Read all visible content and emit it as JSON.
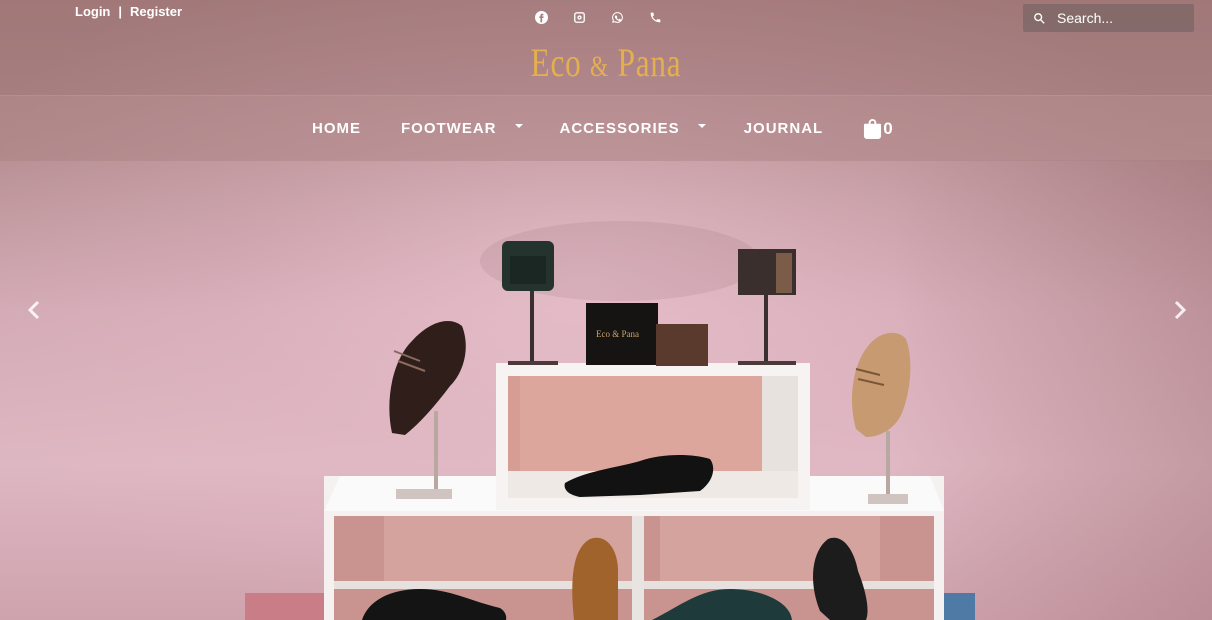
{
  "header": {
    "login_label": "Login",
    "separator": "|",
    "register_label": "Register",
    "social_icons": [
      "facebook-icon",
      "instagram-icon",
      "whatsapp-icon",
      "phone-icon"
    ],
    "search_placeholder": "Search...",
    "logo_part1": "Eco",
    "logo_amp": "&",
    "logo_part2": "Pana",
    "logo_color": "#e4b04f"
  },
  "nav": {
    "items": [
      {
        "label": "HOME",
        "has_dropdown": false
      },
      {
        "label": "FOOTWEAR",
        "has_dropdown": true
      },
      {
        "label": "ACCESSORIES",
        "has_dropdown": true
      },
      {
        "label": "JOURNAL",
        "has_dropdown": false
      }
    ],
    "cart_count": "0"
  },
  "hero": {
    "box_label": "Eco & Pana"
  }
}
